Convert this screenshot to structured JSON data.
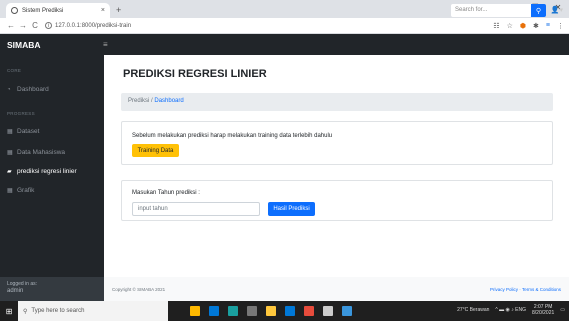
{
  "browser": {
    "tab_title": "Sistem Prediksi",
    "tab_close": "×",
    "new_tab": "+",
    "window_controls": [
      "⌄",
      "–",
      "❐",
      "✕"
    ],
    "back": "←",
    "forward": "→",
    "reload": "C",
    "url": "127.0.0.1:8000/prediksi-train",
    "extensions": [
      "☷",
      "☆",
      "⬢",
      "✱",
      "≡",
      "⋮"
    ]
  },
  "navbar": {
    "brand": "SIMABA",
    "toggle": "≡",
    "search_placeholder": "Search for...",
    "search_icon": "⚲",
    "user_icon": "👤▾"
  },
  "sidebar": {
    "sections": [
      {
        "heading": "CORE",
        "items": [
          {
            "icon": "◔",
            "label": "Dashboard",
            "active": false
          }
        ]
      },
      {
        "heading": "PROGRESS",
        "items": [
          {
            "icon": "▦",
            "label": "Dataset",
            "active": false
          },
          {
            "icon": "▦",
            "label": "Data Mahasiswa",
            "active": false
          },
          {
            "icon": "▰",
            "label": "prediksi regresi linier",
            "active": true
          },
          {
            "icon": "▦",
            "label": "Grafik",
            "active": false
          }
        ]
      }
    ],
    "footer_line1": "Logged in as:",
    "footer_line2": "admin"
  },
  "main": {
    "title": "PREDIKSI REGRESI LINIER",
    "breadcrumb": {
      "parent": "Prediksi /",
      "current": "Dashboard"
    },
    "notice": "Sebelum melakukan prediksi harap melakukan training data terlebih dahulu",
    "training_button": "Training Data",
    "year_label": "Masukan Tahun prediksi :",
    "year_placeholder": "input tahun",
    "predict_button": "Hasil Prediksi",
    "footer_copyright": "Copyright © SIMABA 2021",
    "footer_links": "Privacy Policy · Terms & Conditions"
  },
  "taskbar": {
    "start_icon": "⊞",
    "search_icon": "⚲",
    "search_placeholder": "Type here to search",
    "apps": [
      "#ffb900",
      "#0078d7",
      "#1aa0a0",
      "#777777",
      "#ffc83d",
      "#0078d7",
      "#e74c3c",
      "#cccccc",
      "#3a96dd"
    ],
    "weather": "27°C Berawan",
    "tray_icons": "^ ▬ ◉ ♪ ENG",
    "time": "2:07 PM",
    "date": "8/20/2021",
    "notification_icon": "▭"
  }
}
